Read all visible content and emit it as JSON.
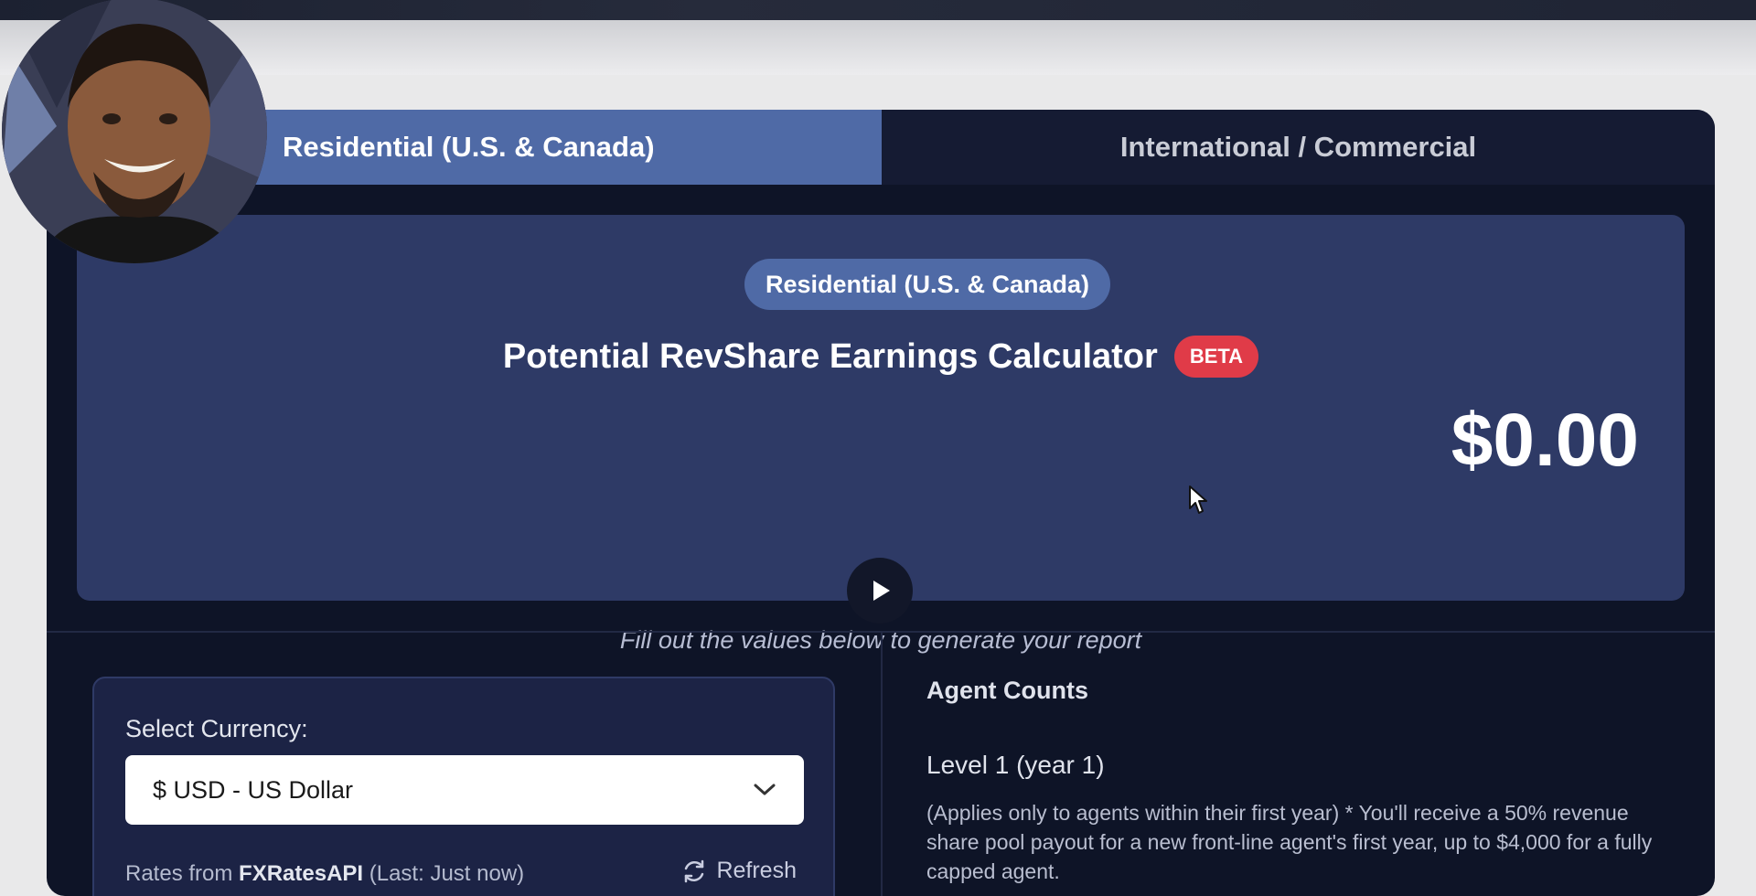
{
  "tabs": [
    {
      "label": "Residential (U.S. & Canada)",
      "active": true
    },
    {
      "label": "International / Commercial",
      "active": false
    }
  ],
  "hero": {
    "pill_label": "Residential (U.S. & Canada)",
    "title": "Potential RevShare Earnings Calculator",
    "badge": "BETA",
    "amount": "$0.00",
    "hint": "Fill out the values below to generate your report"
  },
  "currency": {
    "label": "Select Currency:",
    "selected": "$ USD - US Dollar",
    "rates_prefix": "Rates from ",
    "rates_source": "FXRatesAPI",
    "rates_suffix": " (Last: Just now)",
    "refresh_label": "Refresh"
  },
  "agents": {
    "title": "Agent Counts",
    "level_label": "Level 1 (year 1)",
    "description": "(Applies only to agents within their first year) * You'll receive a 50% revenue share pool payout for a new front-line agent's first year, up to $4,000 for a fully capped agent."
  },
  "colors": {
    "accent": "#4f6aa6",
    "badge": "#e03b48",
    "panel": "#0e1427",
    "hero": "#2e3a66"
  },
  "icons": {
    "play": "play-icon",
    "chevron": "chevron-down-icon",
    "refresh": "refresh-icon",
    "cursor": "cursor-icon"
  }
}
